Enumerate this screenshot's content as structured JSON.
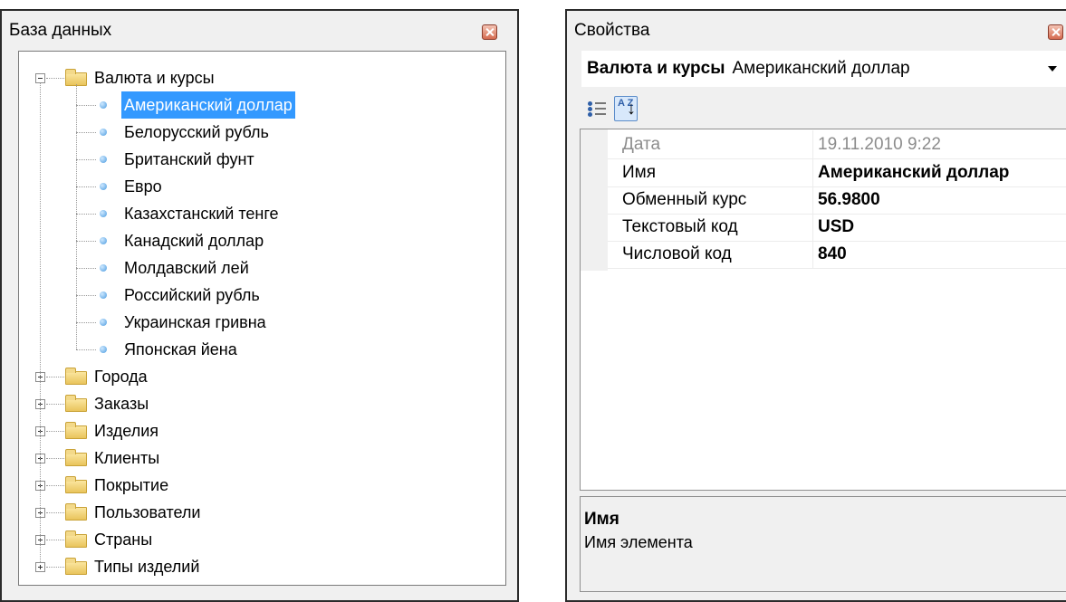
{
  "db_panel": {
    "title": "База данных",
    "tree": {
      "root": {
        "label": "Валюта и курсы",
        "expanded": true
      },
      "children": [
        "Американский доллар",
        "Белорусский рубль",
        "Британский фунт",
        "Евро",
        "Казахстанский тенге",
        "Канадский доллар",
        "Молдавский лей",
        "Российский рубль",
        "Украинская гривна",
        "Японская йена"
      ],
      "selected_child": "Американский доллар",
      "collapsed_folders": [
        "Города",
        "Заказы",
        "Изделия",
        "Клиенты",
        "Покрытие",
        "Пользователи",
        "Страны",
        "Типы изделий"
      ]
    }
  },
  "properties_panel": {
    "title": "Свойства",
    "object": {
      "type": "Валюта и курсы",
      "name": "Американский доллар"
    },
    "toolbar": {
      "categorized_icon": "categorized-view-icon",
      "alphabetical_icon": "sort-az-icon",
      "alphabetical_text": "A Z"
    },
    "properties": [
      {
        "name": "Дата",
        "value": "19.11.2010 9:22",
        "disabled": true
      },
      {
        "name": "Имя",
        "value": "Американский доллар",
        "bold": true
      },
      {
        "name": "Обменный курс",
        "value": "56.9800",
        "bold": true
      },
      {
        "name": "Текстовый код",
        "value": "USD",
        "bold": true
      },
      {
        "name": "Числовой код",
        "value": "840",
        "bold": true
      }
    ],
    "help": {
      "title": "Имя",
      "description": "Имя элемента"
    }
  },
  "colors": {
    "selection": "#3399ff",
    "panel_bg": "#f0f0f0",
    "folder": "#e9c45c",
    "item_dot": "#4b9be0"
  }
}
